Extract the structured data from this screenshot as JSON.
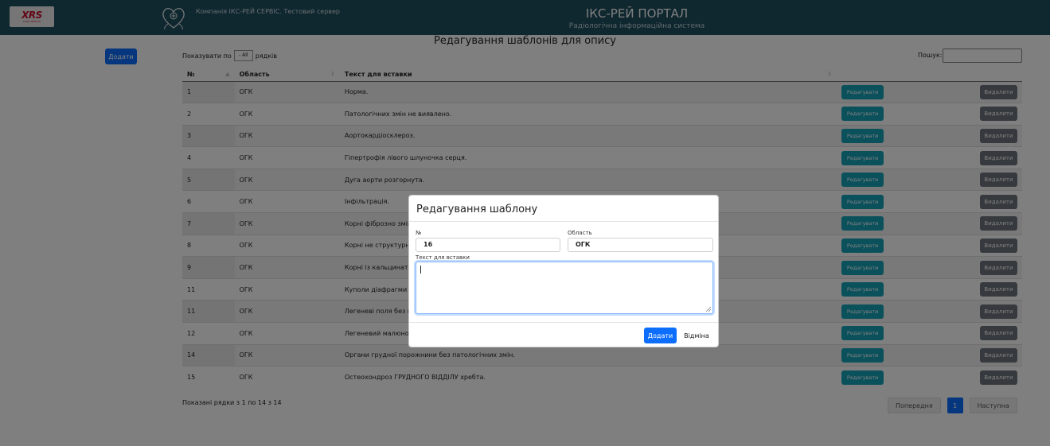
{
  "header": {
    "logo_text": "XRS",
    "logo_sub": "X-RAY SERVICE",
    "company": "Компанія ІКС-РЕЙ СЕРВІС. Тестовий сервер",
    "title": "ІКС-РЕЙ ПОРТАЛ",
    "subtitle": "Радіологічна інформаційна система"
  },
  "page": {
    "title": "Редагування шаблонів для опису",
    "add_button": "Додати",
    "show_prefix": "Показувати по",
    "show_value": "- All",
    "show_suffix": "рядків",
    "search_label": "Пошук:",
    "search_value": ""
  },
  "table": {
    "columns": [
      "№",
      "Область",
      "Текст для вставки",
      ""
    ],
    "edit_label": "Редагувати",
    "delete_label": "Видалити",
    "rows": [
      {
        "num": "1",
        "area": "ОГК",
        "text": "Норма."
      },
      {
        "num": "2",
        "area": "ОГК",
        "text": "Патологічних змін не виявлено."
      },
      {
        "num": "3",
        "area": "ОГК",
        "text": "Аортокардіосклероз."
      },
      {
        "num": "4",
        "area": "ОГК",
        "text": "Гіпертрофія лівого шлуночка серця."
      },
      {
        "num": "5",
        "area": "ОГК",
        "text": "Дуга аорти розгорнута."
      },
      {
        "num": "6",
        "area": "ОГК",
        "text": "Інфільтрація."
      },
      {
        "num": "7",
        "area": "ОГК",
        "text": "Корні фіброзно змін"
      },
      {
        "num": "8",
        "area": "ОГК",
        "text": "Корні не структурні."
      },
      {
        "num": "9",
        "area": "ОГК",
        "text": "Корні із кальцинатам"
      },
      {
        "num": "11",
        "area": "ОГК",
        "text": "Куполи діафрагми п"
      },
      {
        "num": "11",
        "area": "ОГК",
        "text": "Легеневі поля без в"
      },
      {
        "num": "12",
        "area": "ОГК",
        "text": "Легеневий малюнок"
      },
      {
        "num": "14",
        "area": "ОГК",
        "text": "Органи грудної порожнини без патологічних змін."
      },
      {
        "num": "15",
        "area": "ОГК",
        "text": "Остеохондроз ГРУДНОГО ВІДДІЛУ хребта."
      }
    ],
    "info": "Показані рядки з 1 по 14 з 14"
  },
  "pagination": {
    "prev": "Попередня",
    "current": "1",
    "next": "Наступна"
  },
  "modal": {
    "title": "Редагування шаблону",
    "num_label": "№",
    "num_value": "16",
    "area_label": "Область",
    "area_value": "ОГК",
    "text_label": "Текст для вставки",
    "text_value": "",
    "add_button": "Додати",
    "cancel_button": "Відміна"
  },
  "colors": {
    "header_bg": "#1f4e5f",
    "primary": "#0d6efd",
    "edit_button": "#17a2b8",
    "delete_button": "#6c757d"
  }
}
